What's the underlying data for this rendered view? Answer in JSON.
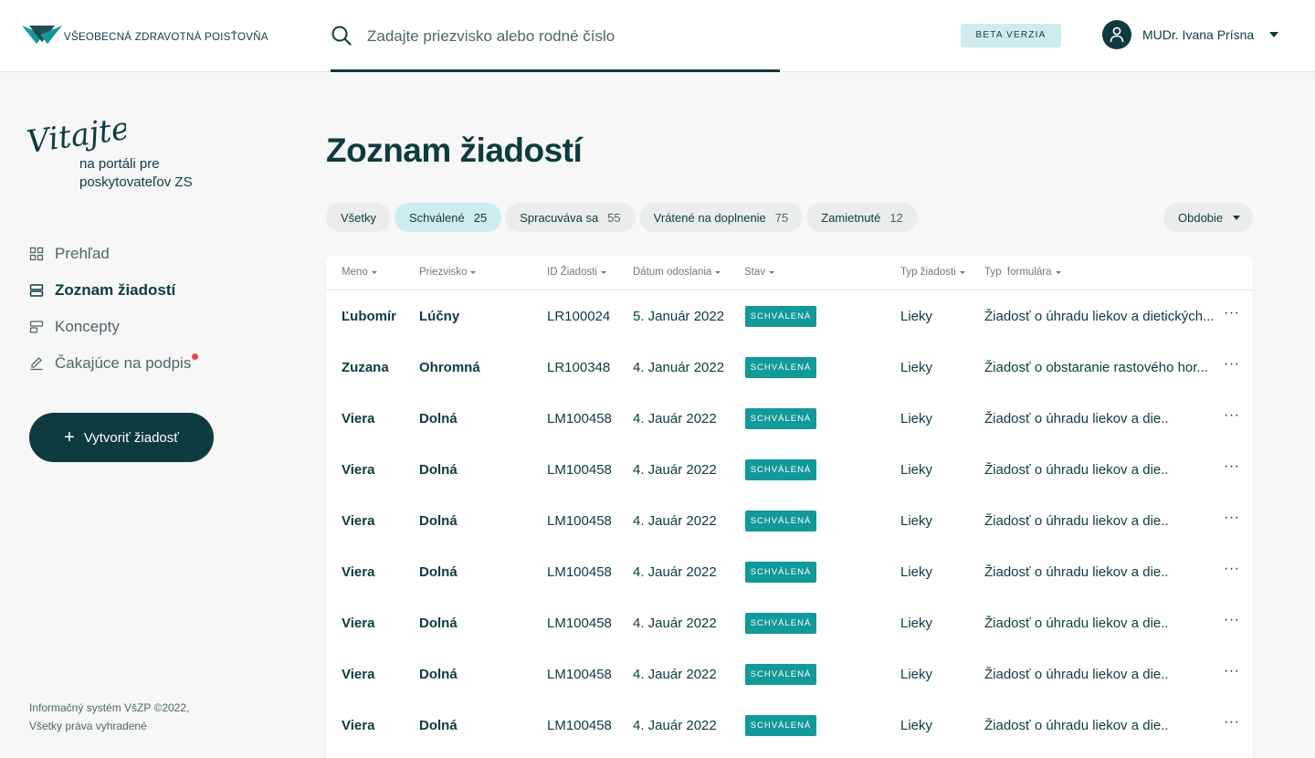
{
  "brand": {
    "name": "VŠEOBECNÁ ZDRAVOTNÁ POISŤOVŇA",
    "color_primary": "#0d3b40",
    "color_accent": "#12999a",
    "color_chip_active": "#cfeced"
  },
  "search": {
    "placeholder": "Zadajte priezvisko alebo rodné číslo",
    "value": ""
  },
  "header": {
    "beta_label": "BETA VERZIA",
    "user_name": "MUDr. Ivana Prísna"
  },
  "sidebar": {
    "welcome_script": "Vitajte,",
    "welcome_line1": "na portáli pre",
    "welcome_line2": "poskytovateľov ZS",
    "items": [
      {
        "label": "Prehľad",
        "icon": "grid-icon"
      },
      {
        "label": "Zoznam žiadostí",
        "icon": "list-icon",
        "active": true
      },
      {
        "label": "Koncepty",
        "icon": "draft-icon"
      },
      {
        "label": "Čakajúce na podpis",
        "icon": "pen-icon",
        "notification": true
      }
    ],
    "create_button": "Vytvoriť žiadosť",
    "footer_line1": "Informačný systém VšZP ©2022,",
    "footer_line2": "Všetky práva vyhradené"
  },
  "main": {
    "title": "Zoznam žiadostí",
    "filters": [
      {
        "label": "Všetky",
        "count": ""
      },
      {
        "label": "Schválené",
        "count": "25",
        "active": true
      },
      {
        "label": "Spracuváva sa",
        "count": "55"
      },
      {
        "label": "Vrátené na doplnenie",
        "count": "75"
      },
      {
        "label": "Zamietnuté",
        "count": "12"
      }
    ],
    "period_label": "Obdobie"
  },
  "table": {
    "columns": [
      "Meno",
      "Priezvisko",
      "ID Žiadosti",
      "Dátum odoslania",
      "Stav",
      "Typ žiadosti",
      "Typ  formulára"
    ],
    "rows": [
      {
        "meno": "Ľubomír",
        "priezvisko": "Lúčny",
        "id": "LR100024",
        "datum": "5. Január 2022",
        "stav": "SCHVÁLENÁ",
        "typ": "Lieky",
        "formular": "Žiadosť o úhradu liekov a dietických..."
      },
      {
        "meno": "Zuzana",
        "priezvisko": "Ohromná",
        "id": "LR100348",
        "datum": "4. Január 2022",
        "stav": "SCHVÁLENÁ",
        "typ": "Lieky",
        "formular": "Žiadosť o obstaranie rastového hor..."
      },
      {
        "meno": "Viera",
        "priezvisko": "Dolná",
        "id": "LM100458",
        "datum": "4. Jauár 2022",
        "stav": "SCHVÁLENÁ",
        "typ": "Lieky",
        "formular": "Žiadosť o úhradu liekov a die.."
      },
      {
        "meno": "Viera",
        "priezvisko": "Dolná",
        "id": "LM100458",
        "datum": "4. Jauár 2022",
        "stav": "SCHVÁLENÁ",
        "typ": "Lieky",
        "formular": "Žiadosť o úhradu liekov a die.."
      },
      {
        "meno": "Viera",
        "priezvisko": "Dolná",
        "id": "LM100458",
        "datum": "4. Jauár 2022",
        "stav": "SCHVÁLENÁ",
        "typ": "Lieky",
        "formular": "Žiadosť o úhradu liekov a die.."
      },
      {
        "meno": "Viera",
        "priezvisko": "Dolná",
        "id": "LM100458",
        "datum": "4. Jauár 2022",
        "stav": "SCHVÁLENÁ",
        "typ": "Lieky",
        "formular": "Žiadosť o úhradu liekov a die.."
      },
      {
        "meno": "Viera",
        "priezvisko": "Dolná",
        "id": "LM100458",
        "datum": "4. Jauár 2022",
        "stav": "SCHVÁLENÁ",
        "typ": "Lieky",
        "formular": "Žiadosť o úhradu liekov a die.."
      },
      {
        "meno": "Viera",
        "priezvisko": "Dolná",
        "id": "LM100458",
        "datum": "4. Jauár 2022",
        "stav": "SCHVÁLENÁ",
        "typ": "Lieky",
        "formular": "Žiadosť o úhradu liekov a die.."
      },
      {
        "meno": "Viera",
        "priezvisko": "Dolná",
        "id": "LM100458",
        "datum": "4. Jauár 2022",
        "stav": "SCHVÁLENÁ",
        "typ": "Lieky",
        "formular": "Žiadosť o úhradu liekov a die.."
      }
    ],
    "row_action_icon": "more-icon",
    "row_action_glyph": "···"
  }
}
